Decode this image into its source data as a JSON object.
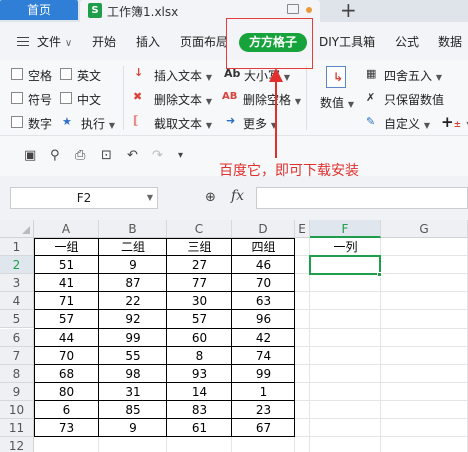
{
  "tabs": {
    "home": "首页",
    "file_icon_letter": "S",
    "file": "工作簿1.xlsx",
    "new_tab": "+"
  },
  "menu": [
    {
      "label": "文件",
      "chevron": "∨"
    },
    {
      "label": "开始"
    },
    {
      "label": "插入"
    },
    {
      "label": "页面布局"
    },
    {
      "label": "方方格子"
    },
    {
      "label": "DIY工具箱"
    },
    {
      "label": "公式"
    },
    {
      "label": "数据"
    }
  ],
  "toolbar": {
    "checkboxes": [
      "空格",
      "英文",
      "符号",
      "中文",
      "数字"
    ],
    "execute": "执行",
    "insert_text": "插入文本",
    "delete_text": "删除文本",
    "cut_text": "截取文本",
    "case": "大小写",
    "delete_space": "删除空格",
    "more": "更多",
    "number": "数值",
    "round": "四舍五入",
    "keep_number": "只保留数值",
    "custom": "自定义",
    "plus": "+",
    "icon_labels": {
      "case": "Ab",
      "delete_space": "AB",
      "plus_minus": "±"
    }
  },
  "annotation": "百度它，即可下载安装",
  "formula_bar": {
    "name_box": "F2",
    "fx": "fx"
  },
  "grid": {
    "columns": [
      "A",
      "B",
      "C",
      "D",
      "E",
      "F",
      "G"
    ],
    "rows": [
      "1",
      "2",
      "3",
      "4",
      "5",
      "6",
      "7",
      "8",
      "9",
      "10",
      "11",
      "12"
    ],
    "selected_column": "F",
    "selected_row": "2",
    "header": [
      "一组",
      "二组",
      "三组",
      "四组"
    ],
    "data": [
      [
        51,
        9,
        27,
        46
      ],
      [
        41,
        87,
        77,
        70
      ],
      [
        71,
        22,
        30,
        63
      ],
      [
        57,
        92,
        57,
        96
      ],
      [
        44,
        99,
        60,
        42
      ],
      [
        70,
        55,
        8,
        74
      ],
      [
        68,
        98,
        93,
        99
      ],
      [
        80,
        31,
        14,
        1
      ],
      [
        6,
        85,
        83,
        23
      ],
      [
        73,
        9,
        61,
        67
      ]
    ],
    "f1": "一列"
  },
  "colors": {
    "accent_green": "#16a33c",
    "home_tab_blue": "#2f7fd6",
    "annotation_red": "#e0302e"
  }
}
